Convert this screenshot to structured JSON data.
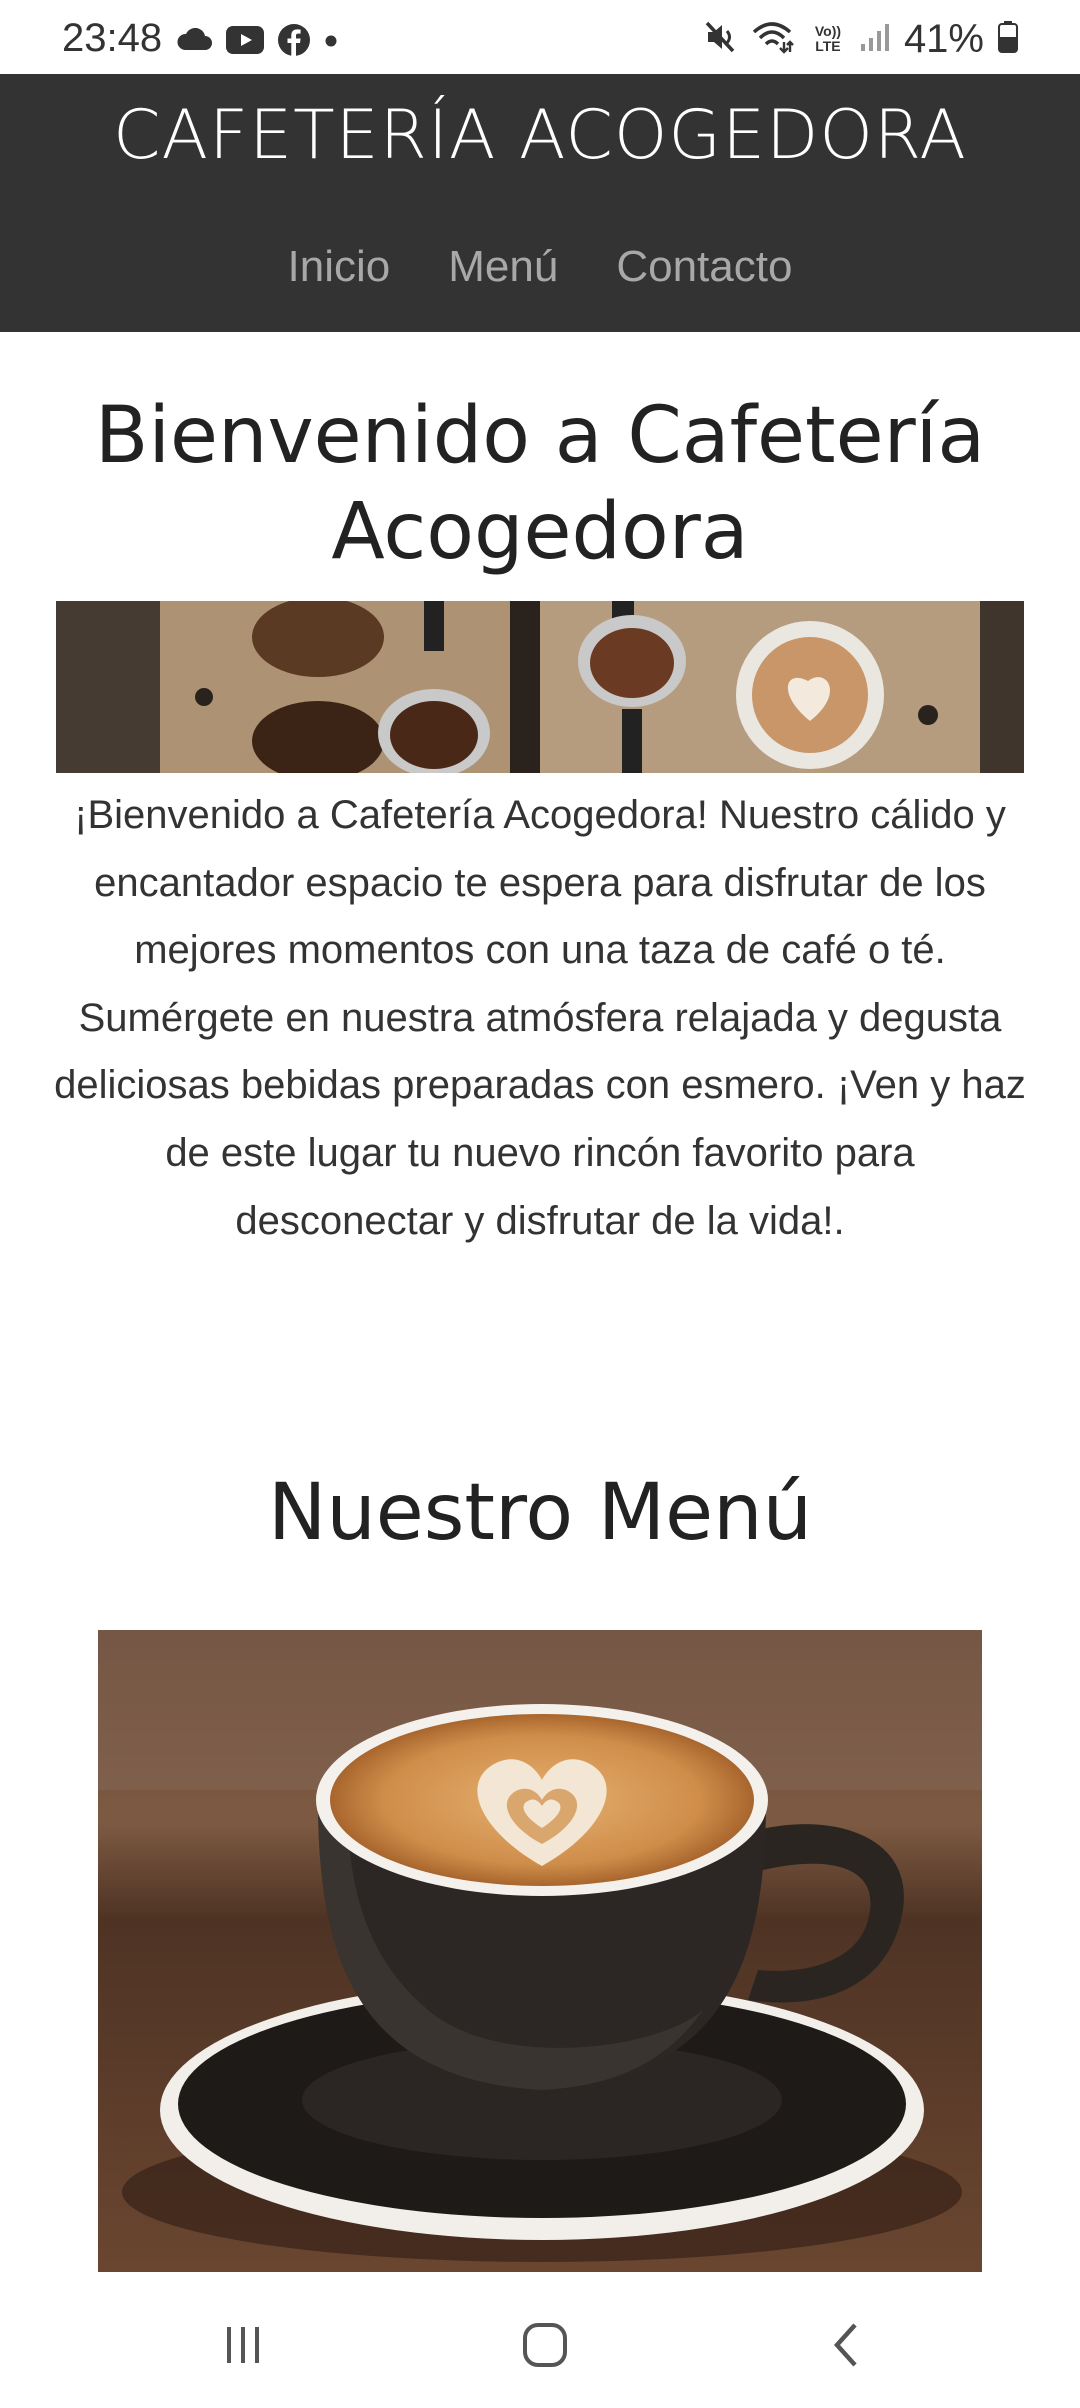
{
  "status_bar": {
    "time": "23:48",
    "battery": "41%",
    "left_icons": [
      "cloud-icon",
      "youtube-icon",
      "facebook-icon",
      "dot-icon"
    ],
    "right_icons": [
      "mute-icon",
      "wifi-icon",
      "volte-icon",
      "signal-icon",
      "battery-icon"
    ],
    "volte_label": "Vo)) LTE"
  },
  "header": {
    "brand": "CAFETERÍA ACOGEDORA",
    "nav": [
      "Inicio",
      "Menú",
      "Contacto"
    ]
  },
  "hero": {
    "title": "Bienvenido a Cafetería Acogedora",
    "description": "¡Bienvenido a Cafetería Acogedora! Nuestro cálido y encantador espacio te espera para disfrutar de los mejores momentos con una taza de café o té. Sumérgete en nuestra atmósfera relajada y degusta deliciosas bebidas preparadas con esmero. ¡Ven y haz de este lugar tu nuevo rincón favorito para desconectar y disfrutar de la vida!."
  },
  "menu": {
    "title": "Nuestro Menú"
  },
  "nav_bar": {
    "icons": [
      "recents-icon",
      "home-icon",
      "back-icon"
    ]
  },
  "colors": {
    "header_bg": "#333333",
    "nav_link": "#a8a8a8",
    "text": "#333333"
  }
}
